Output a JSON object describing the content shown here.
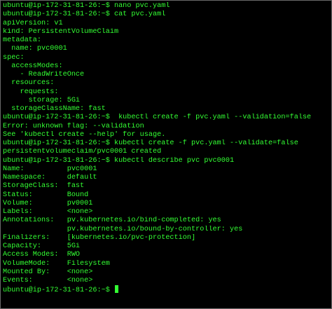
{
  "terminal": {
    "text_color": "#33ff33",
    "background_color": "#000000",
    "lines": [
      "ubuntu@ip-172-31-81-26:~$ nano pvc.yaml",
      "ubuntu@ip-172-31-81-26:~$ cat pvc.yaml",
      "apiVersion: v1",
      "kind: PersistentVolumeClaim",
      "metadata:",
      "  name: pvc0001",
      "spec:",
      "  accessModes:",
      "    - ReadWriteOnce",
      "  resources:",
      "    requests:",
      "      storage: 5Gi",
      "  storageClassName: fast",
      "ubuntu@ip-172-31-81-26:~$  kubectl create -f pvc.yaml --validation=false",
      "Error: unknown flag: --validation",
      "See 'kubectl create --help' for usage.",
      "ubuntu@ip-172-31-81-26:~$ kubectl create -f pvc.yaml --validate=false",
      "persistentvolumeclaim/pvc0001 created",
      "ubuntu@ip-172-31-81-26:~$ kubectl describe pvc pvc0001",
      "Name:          pvc0001",
      "Namespace:     default",
      "StorageClass:  fast",
      "Status:        Bound",
      "Volume:        pv0001",
      "Labels:        <none>",
      "Annotations:   pv.kubernetes.io/bind-completed: yes",
      "               pv.kubernetes.io/bound-by-controller: yes",
      "Finalizers:    [kubernetes.io/pvc-protection]",
      "Capacity:      5Gi",
      "Access Modes:  RWO",
      "VolumeMode:    Filesystem",
      "Mounted By:    <none>",
      "Events:        <none>",
      "ubuntu@ip-172-31-81-26:~$ "
    ]
  }
}
